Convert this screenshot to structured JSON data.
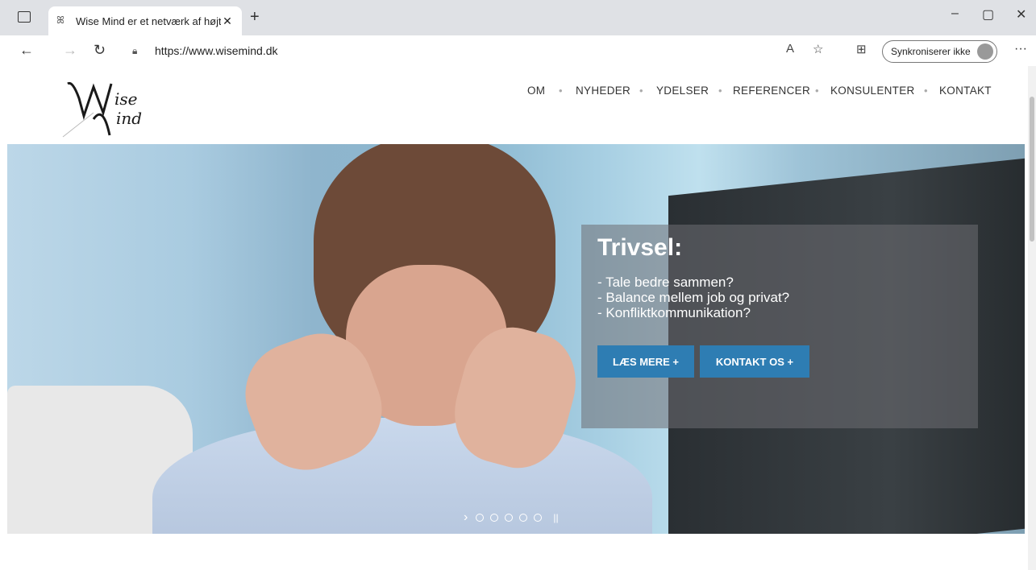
{
  "browser": {
    "tab_title": "Wise Mind er et netværk af højtu",
    "url": "https://www.wisemind.dk",
    "sync_label": "Synkroniserer ikke"
  },
  "site": {
    "logo_text": "Wise Mind",
    "menu": [
      "OM",
      "NYHEDER",
      "YDELSER",
      "REFERENCER",
      "KONSULENTER",
      "KONTAKT"
    ]
  },
  "hero": {
    "title": "Trivsel:",
    "lines": [
      "- Tale bedre sammen?",
      "- Balance mellem job og privat?",
      "- Konfliktkommunikation?"
    ],
    "buttons": [
      "LÆS MERE +",
      "KONTAKT OS +"
    ],
    "slides_count": 5
  }
}
